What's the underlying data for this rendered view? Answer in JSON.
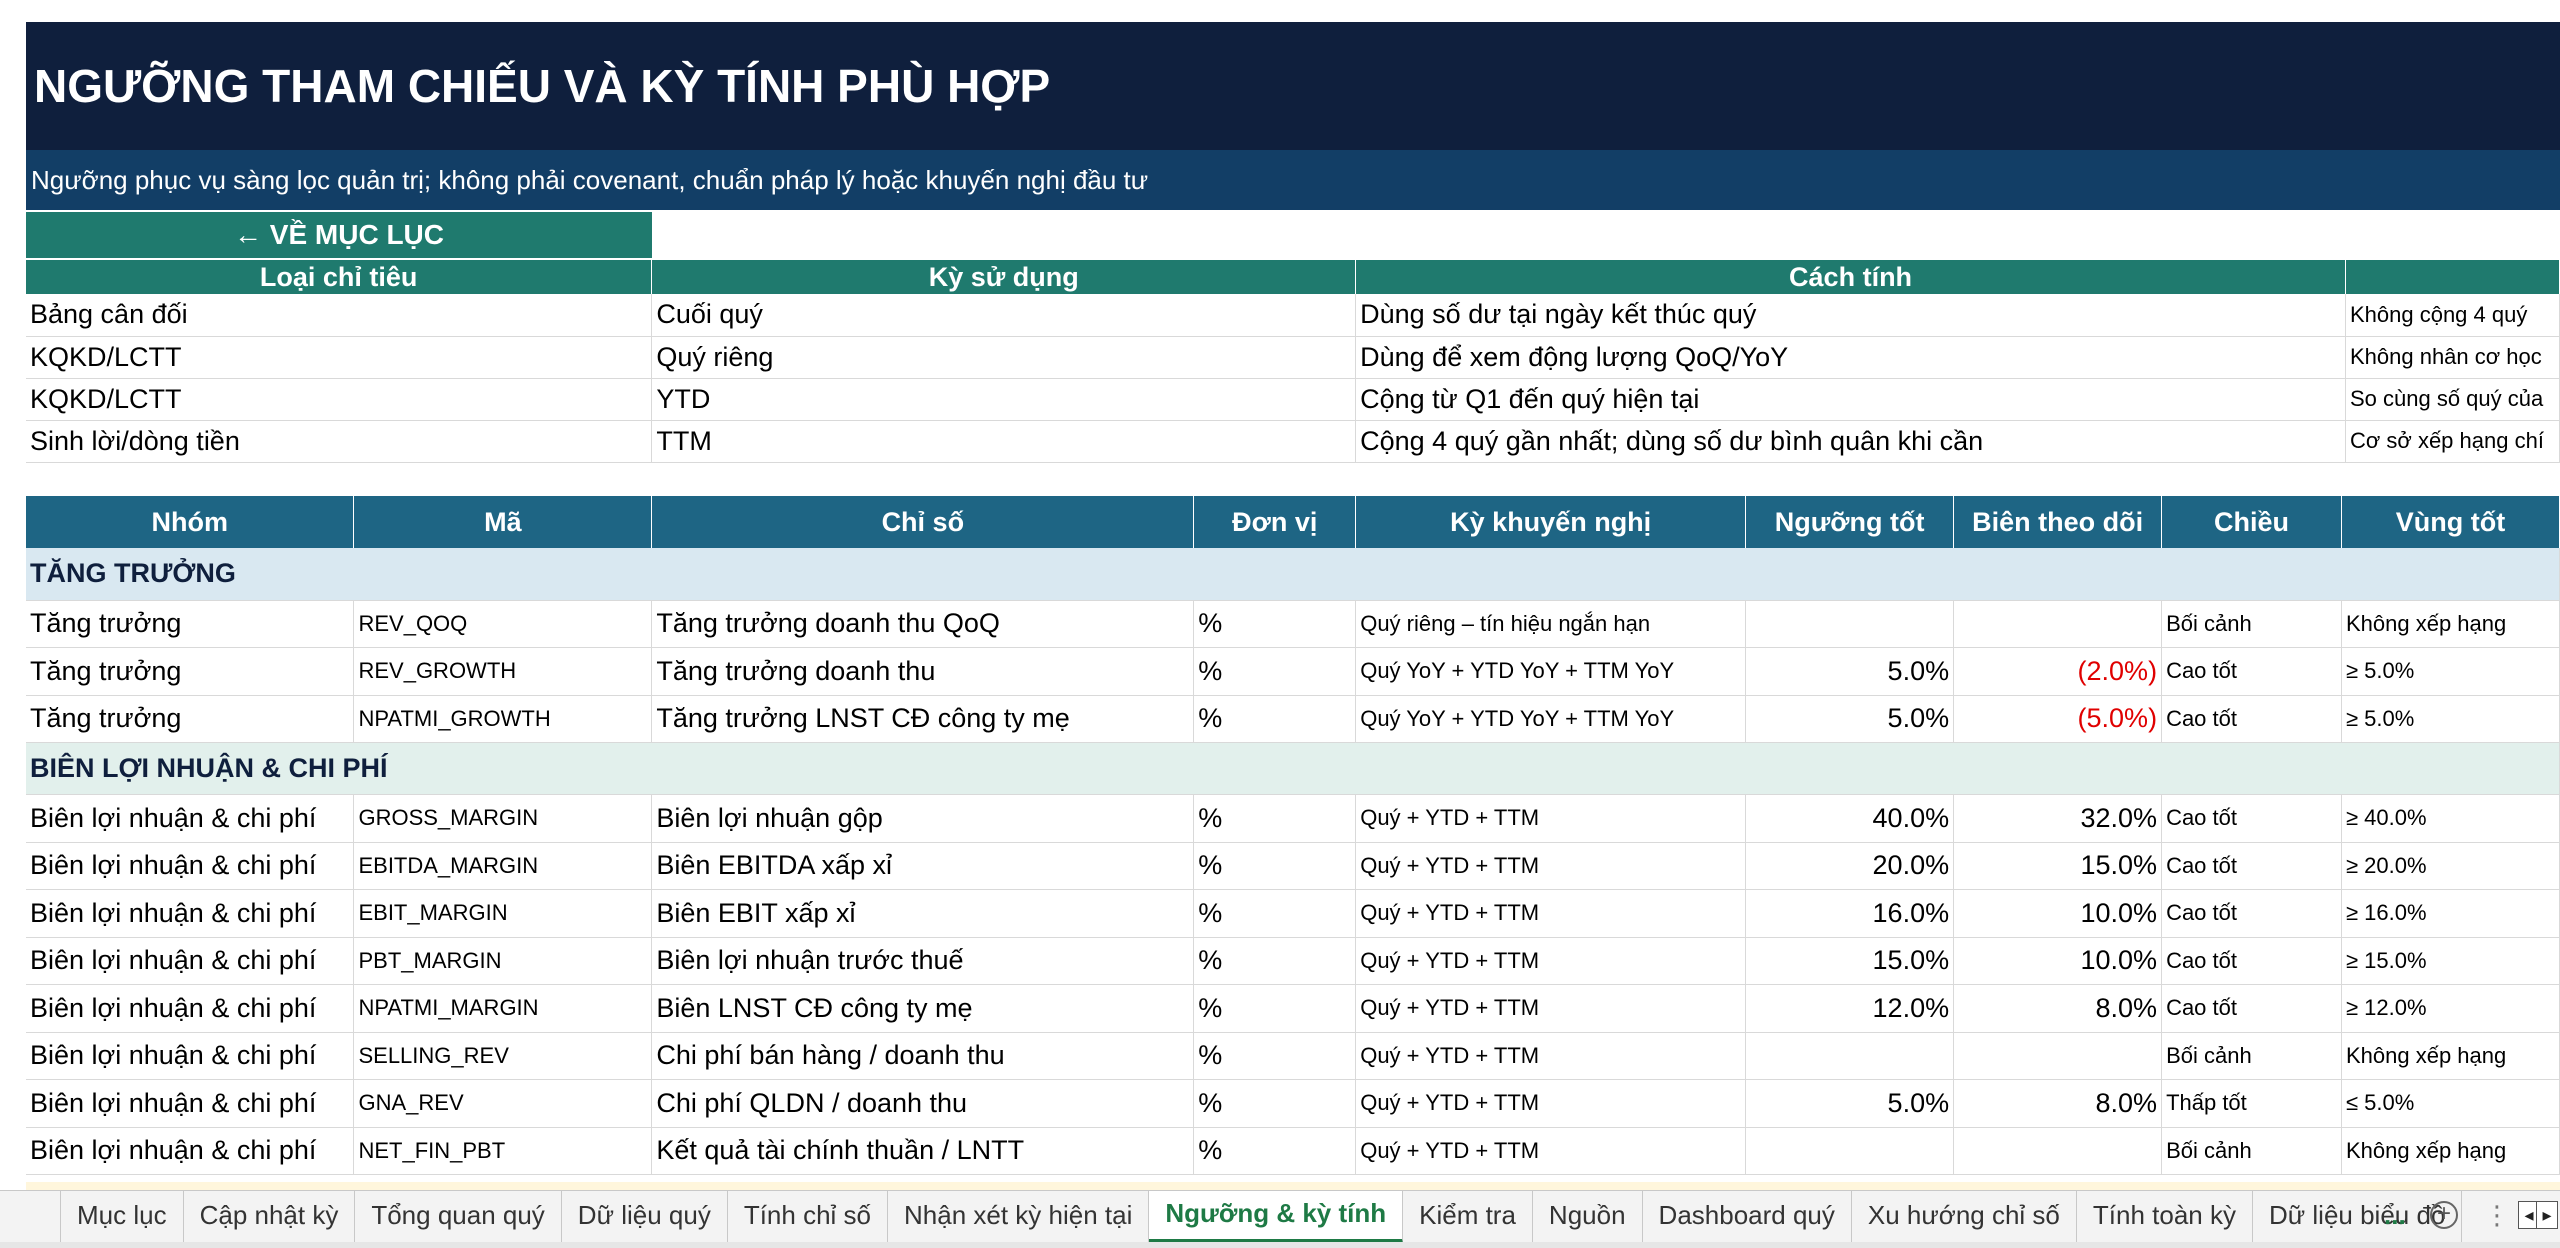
{
  "title": "NGƯỠNG THAM CHIẾU VÀ KỲ TÍNH PHÙ HỢP",
  "subtitle": "Ngưỡng phục vụ sàng lọc quản trị; không phải covenant, chuẩn pháp lý hoặc khuyến nghị đầu tư",
  "back_button": "← VỀ MỤC LỤC",
  "period_table": {
    "headers": [
      "Loại chỉ tiêu",
      "Kỳ sử dụng",
      "Cách tính",
      ""
    ],
    "rows": [
      [
        "Bảng cân đối",
        "Cuối quý",
        "Dùng số dư tại ngày kết thúc quý",
        "Không cộng 4 quý"
      ],
      [
        "KQKD/LCTT",
        "Quý riêng",
        "Dùng để xem động lượng QoQ/YoY",
        "Không nhân cơ học"
      ],
      [
        "KQKD/LCTT",
        "YTD",
        "Cộng từ Q1 đến quý hiện tại",
        "So cùng số quý của"
      ],
      [
        "Sinh lời/dòng tiền",
        "TTM",
        "Cộng 4 quý gần nhất; dùng số dư bình quân khi cần",
        "Cơ sở xếp hạng chí"
      ]
    ]
  },
  "indicator_table": {
    "headers": [
      "Nhóm",
      "Mã",
      "Chỉ số",
      "Đơn vị",
      "Kỳ khuyến nghị",
      "Ngưỡng tốt",
      "Biên theo dõi",
      "Chiều",
      "Vùng tốt"
    ],
    "groups": [
      {
        "name": "TĂNG TRƯỞNG",
        "rows": [
          {
            "group": "Tăng trưởng",
            "code": "REV_QOQ",
            "name": "Tăng trưởng doanh thu QoQ",
            "unit": "%",
            "period": "Quý riêng – tín hiệu ngắn hạn",
            "good": "",
            "watch": "",
            "direction": "Bối cảnh",
            "zone": "Không xếp hạng"
          },
          {
            "group": "Tăng trưởng",
            "code": "REV_GROWTH",
            "name": "Tăng trưởng doanh thu",
            "unit": "%",
            "period": "Quý YoY + YTD YoY + TTM YoY",
            "good": "5.0%",
            "watch": "(2.0%)",
            "direction": "Cao tốt",
            "zone": "≥ 5.0%"
          },
          {
            "group": "Tăng trưởng",
            "code": "NPATMI_GROWTH",
            "name": "Tăng trưởng LNST CĐ công ty mẹ",
            "unit": "%",
            "period": "Quý YoY + YTD YoY + TTM YoY",
            "good": "5.0%",
            "watch": "(5.0%)",
            "direction": "Cao tốt",
            "zone": "≥ 5.0%"
          }
        ]
      },
      {
        "name": "BIÊN LỢI NHUẬN & CHI PHÍ",
        "rows": [
          {
            "group": "Biên lợi nhuận & chi phí",
            "code": "GROSS_MARGIN",
            "name": "Biên lợi nhuận gộp",
            "unit": "%",
            "period": "Quý + YTD + TTM",
            "good": "40.0%",
            "watch": "32.0%",
            "direction": "Cao tốt",
            "zone": "≥ 40.0%"
          },
          {
            "group": "Biên lợi nhuận & chi phí",
            "code": "EBITDA_MARGIN",
            "name": "Biên EBITDA xấp xỉ",
            "unit": "%",
            "period": "Quý + YTD + TTM",
            "good": "20.0%",
            "watch": "15.0%",
            "direction": "Cao tốt",
            "zone": "≥ 20.0%"
          },
          {
            "group": "Biên lợi nhuận & chi phí",
            "code": "EBIT_MARGIN",
            "name": "Biên EBIT xấp xỉ",
            "unit": "%",
            "period": "Quý + YTD + TTM",
            "good": "16.0%",
            "watch": "10.0%",
            "direction": "Cao tốt",
            "zone": "≥ 16.0%"
          },
          {
            "group": "Biên lợi nhuận & chi phí",
            "code": "PBT_MARGIN",
            "name": "Biên lợi nhuận trước thuế",
            "unit": "%",
            "period": "Quý + YTD + TTM",
            "good": "15.0%",
            "watch": "10.0%",
            "direction": "Cao tốt",
            "zone": "≥ 15.0%"
          },
          {
            "group": "Biên lợi nhuận & chi phí",
            "code": "NPATMI_MARGIN",
            "name": "Biên LNST CĐ công ty mẹ",
            "unit": "%",
            "period": "Quý + YTD + TTM",
            "good": "12.0%",
            "watch": "8.0%",
            "direction": "Cao tốt",
            "zone": "≥ 12.0%"
          },
          {
            "group": "Biên lợi nhuận & chi phí",
            "code": "SELLING_REV",
            "name": "Chi phí bán hàng / doanh thu",
            "unit": "%",
            "period": "Quý + YTD + TTM",
            "good": "",
            "watch": "",
            "direction": "Bối cảnh",
            "zone": "Không xếp hạng"
          },
          {
            "group": "Biên lợi nhuận & chi phí",
            "code": "GNA_REV",
            "name": "Chi phí QLDN / doanh thu",
            "unit": "%",
            "period": "Quý + YTD + TTM",
            "good": "5.0%",
            "watch": "8.0%",
            "direction": "Thấp tốt",
            "zone": "≤ 5.0%"
          },
          {
            "group": "Biên lợi nhuận & chi phí",
            "code": "NET_FIN_PBT",
            "name": "Kết quả tài chính thuần / LNTT",
            "unit": "%",
            "period": "Quý + YTD + TTM",
            "good": "",
            "watch": "",
            "direction": "Bối cảnh",
            "zone": "Không xếp hạng"
          }
        ]
      }
    ]
  },
  "sheet_tabs": [
    "Mục lục",
    "Cập nhật kỳ",
    "Tổng quan quý",
    "Dữ liệu quý",
    "Tính chỉ số",
    "Nhận xét kỳ hiện tại",
    "Ngưỡng & kỳ tính",
    "Kiểm tra",
    "Nguồn",
    "Dashboard quý",
    "Xu hướng chỉ số",
    "Tính toàn kỳ",
    "Dữ liệu biểu đồ"
  ],
  "active_tab": "Ngưỡng & kỳ tính",
  "more_tabs": "...",
  "add_sheet": "+",
  "colors": {
    "title_bg": "#0f1f3d",
    "subtitle_bg": "#123e66",
    "teal": "#1f7a6e",
    "header_blue": "#1e6584",
    "negative": "#e00000",
    "active_tab": "#1e7a45"
  }
}
